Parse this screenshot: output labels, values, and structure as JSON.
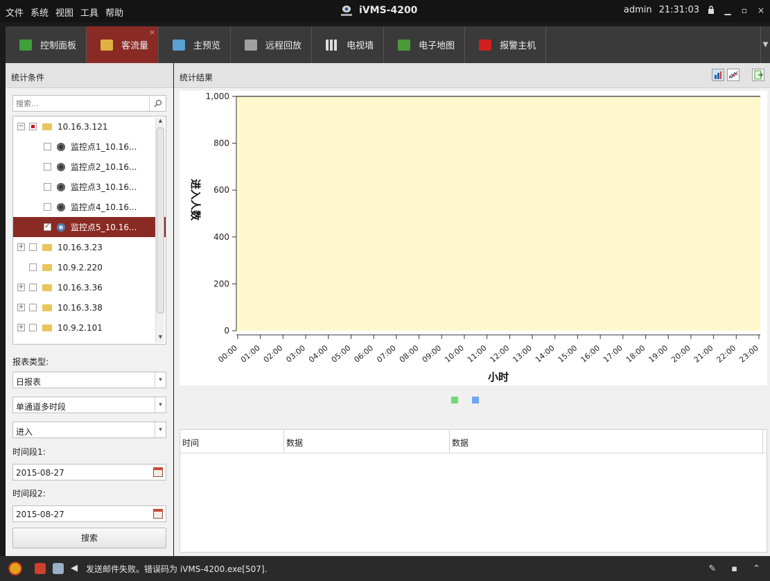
{
  "menu": [
    "文件",
    "系统",
    "视图",
    "工具",
    "帮助"
  ],
  "app_title": "iVMS-4200",
  "user": "admin",
  "clock": "21:31:03",
  "tabs": [
    {
      "label": "控制面板",
      "icon": "control-panel-icon",
      "color": "#3fa03a"
    },
    {
      "label": "客流量",
      "icon": "people-flow-icon",
      "color": "#e0b040"
    },
    {
      "label": "主预览",
      "icon": "main-view-icon",
      "color": "#5aa0d0"
    },
    {
      "label": "远程回放",
      "icon": "remote-playback-icon",
      "color": "#a0a0a0"
    },
    {
      "label": "电视墙",
      "icon": "video-wall-icon",
      "color": "#cfcfcf"
    },
    {
      "label": "电子地图",
      "icon": "emap-icon",
      "color": "#4a9a3a"
    },
    {
      "label": "报警主机",
      "icon": "alarm-host-icon",
      "color": "#d02020"
    }
  ],
  "left": {
    "title": "统计条件",
    "search_placeholder": "搜索...",
    "tree": [
      {
        "label": "10.16.3.121",
        "type": "folder",
        "expander": "−",
        "check": "partial",
        "indent": 0
      },
      {
        "label": "监控点1_10.16...",
        "type": "camera",
        "check": "none",
        "indent": 1
      },
      {
        "label": "监控点2_10.16...",
        "type": "camera",
        "check": "none",
        "indent": 1
      },
      {
        "label": "监控点3_10.16...",
        "type": "camera",
        "check": "none",
        "indent": 1
      },
      {
        "label": "监控点4_10.16...",
        "type": "camera",
        "check": "none",
        "indent": 1
      },
      {
        "label": "监控点5_10.16...",
        "type": "camera",
        "check": "checked",
        "indent": 1,
        "selected": true
      },
      {
        "label": "10.16.3.23",
        "type": "folder",
        "expander": "+",
        "check": "none",
        "indent": 0
      },
      {
        "label": "10.9.2.220",
        "type": "folder",
        "check": "none",
        "indent": 0,
        "noexp": true
      },
      {
        "label": "10.16.3.36",
        "type": "folder",
        "expander": "+",
        "check": "none",
        "indent": 0
      },
      {
        "label": "10.16.3.38",
        "type": "folder",
        "expander": "+",
        "check": "none",
        "indent": 0
      },
      {
        "label": "10.9.2.101",
        "type": "folder",
        "expander": "+",
        "check": "none",
        "indent": 0
      }
    ],
    "report_type_label": "报表类型:",
    "report_type": "日报表",
    "channel_mode": "单通道多时段",
    "direction": "进入",
    "period1_label": "时间段1:",
    "period1": "2015-08-27",
    "period2_label": "时间段2:",
    "period2": "2015-08-27",
    "search_button": "搜索"
  },
  "right": {
    "title": "统计结果",
    "table_headers": [
      "时间",
      "数据",
      "数据"
    ]
  },
  "chart_data": {
    "type": "bar",
    "categories": [
      "00:00",
      "01:00",
      "02:00",
      "03:00",
      "04:00",
      "05:00",
      "06:00",
      "07:00",
      "08:00",
      "09:00",
      "10:00",
      "11:00",
      "12:00",
      "13:00",
      "14:00",
      "15:00",
      "16:00",
      "17:00",
      "18:00",
      "19:00",
      "20:00",
      "21:00",
      "22:00",
      "23:00"
    ],
    "series": [
      {
        "values": [],
        "color": "#6fdc6f"
      },
      {
        "values": [],
        "color": "#6fa8ee"
      }
    ],
    "xlabel": "小时",
    "ylabel": "进入人数",
    "ylim": [
      0,
      1000
    ],
    "yticks": [
      "0",
      "200",
      "400",
      "600",
      "800",
      "1,000"
    ],
    "plot_background": "#fff8cc",
    "grid": false
  },
  "status": {
    "message": "发送邮件失败。错误码为 iVMS-4200.exe[507]."
  }
}
